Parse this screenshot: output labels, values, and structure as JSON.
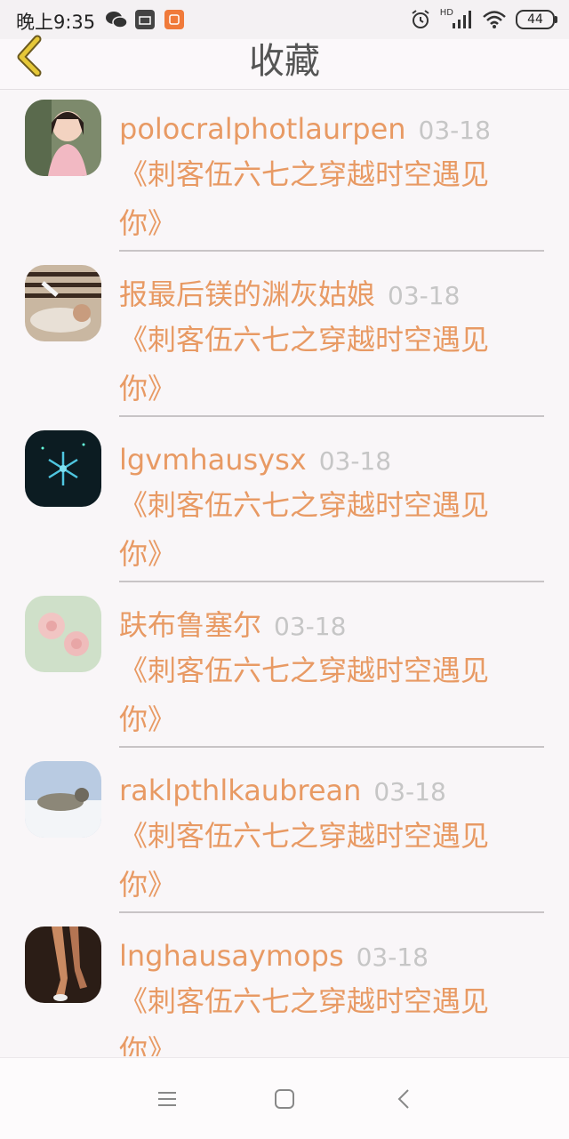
{
  "status_bar": {
    "time": "晚上9:35",
    "network_label": "HD",
    "battery": "44"
  },
  "header": {
    "title": "收藏",
    "back_icon": "chevron-left-icon"
  },
  "favorites": [
    {
      "user": "polocralphotlaurpen",
      "date": "03-18",
      "article": "《刺客伍六七之穿越时空遇见你》"
    },
    {
      "user": "报最后镁的渊灰姑娘",
      "date": "03-18",
      "article": "《刺客伍六七之穿越时空遇见你》"
    },
    {
      "user": "lgvmhausysx",
      "date": "03-18",
      "article": "《刺客伍六七之穿越时空遇见你》"
    },
    {
      "user": "趺布鲁塞尔",
      "date": "03-18",
      "article": "《刺客伍六七之穿越时空遇见你》"
    },
    {
      "user": "raklpthlkaubrean",
      "date": "03-18",
      "article": "《刺客伍六七之穿越时空遇见你》"
    },
    {
      "user": "lnghausaymops",
      "date": "03-18",
      "article": "《刺客伍六七之穿越时空遇见你》"
    }
  ],
  "nav_bar": {
    "menu_icon": "menu-icon",
    "home_icon": "home-square-icon",
    "back_icon": "back-triangle-icon"
  },
  "colors": {
    "accent": "#e89a64",
    "date": "#c6c6c6",
    "back_chevron": "#e0c233"
  }
}
